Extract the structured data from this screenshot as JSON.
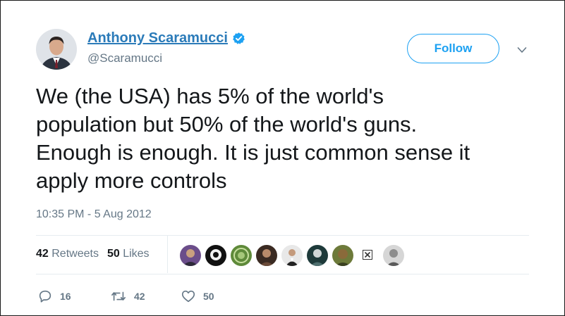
{
  "author": {
    "display_name": "Anthony Scaramucci",
    "handle": "@Scaramucci",
    "verified": true
  },
  "follow_label": "Follow",
  "tweet": {
    "text": "We (the USA) has 5% of the world's\npopulation but 50% of the world's guns.\nEnough is enough. It is just common sense it\napply more controls",
    "timestamp": "10:35 PM - 5 Aug 2012"
  },
  "stats": {
    "retweets_count": "42",
    "retweets_label": "Retweets",
    "likes_count": "50",
    "likes_label": "Likes"
  },
  "actions": {
    "reply_count": "16",
    "retweet_count": "42",
    "like_count": "50"
  },
  "colors": {
    "link_blue": "#2b7bb9",
    "follow_blue": "#1da1f2",
    "muted_gray": "#657786",
    "text": "#14171a",
    "divider": "#e6ecf0"
  },
  "likers_count_shown": 9
}
